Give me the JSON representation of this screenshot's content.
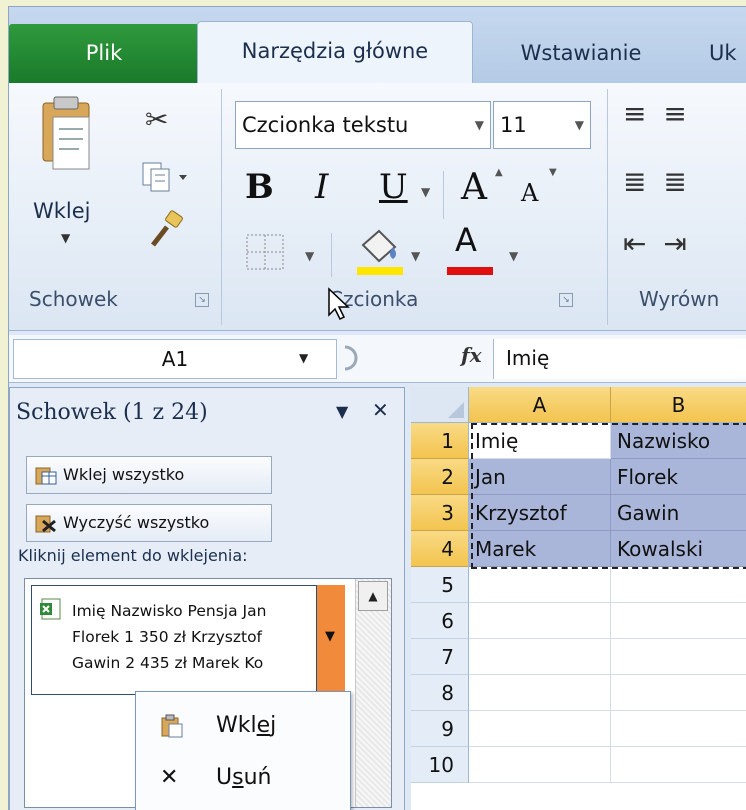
{
  "ribbon": {
    "tabs": [
      {
        "label": "Plik"
      },
      {
        "label": "Narzędzia główne"
      },
      {
        "label": "Wstawianie"
      },
      {
        "label": "Uk"
      }
    ],
    "clipboard_group": {
      "label": "Schowek",
      "paste_label": "Wklej"
    },
    "font_group": {
      "label": "Czcionka",
      "font_name": "Czcionka tekstu",
      "font_size": "11",
      "bold": "B",
      "italic": "I",
      "underline": "U",
      "grow_font": "A",
      "shrink_font": "A",
      "font_color_letter": "A"
    },
    "alignment_group": {
      "label": "Wyrówn"
    }
  },
  "formula_bar": {
    "name_box": "A1",
    "fx": "fx",
    "formula": "Imię"
  },
  "clipboard_pane": {
    "title": "Schowek (1 z 24)",
    "paste_all": "Wklej wszystko",
    "clear_all": "Wyczyść wszystko",
    "hint": "Kliknij element do wklejenia:",
    "item_lines": [
      "Imię Nazwisko Pensja Jan",
      "Florek 1 350 zł Krzysztof",
      "Gawin 2 435 zł Marek Ko"
    ]
  },
  "context_menu": {
    "paste": {
      "before": "Wkl",
      "accel": "e",
      "after": "j"
    },
    "delete": {
      "before": "U",
      "accel": "s",
      "after": "uń"
    }
  },
  "sheet": {
    "columns": [
      "A",
      "B"
    ],
    "rows": [
      "1",
      "2",
      "3",
      "4",
      "5",
      "6",
      "7",
      "8",
      "9",
      "10"
    ],
    "cells": [
      [
        "Imię",
        "Nazwisko"
      ],
      [
        "Jan",
        "Florek"
      ],
      [
        "Krzysztof",
        "Gawin"
      ],
      [
        "Marek",
        "Kowalski"
      ]
    ]
  },
  "colors": {
    "file_tab": "#1a7a2a",
    "highlight_yellow": "#ffe600",
    "font_red": "#e01010",
    "selection": "#aab6d9",
    "dropdown_orange": "#f28a3b"
  }
}
